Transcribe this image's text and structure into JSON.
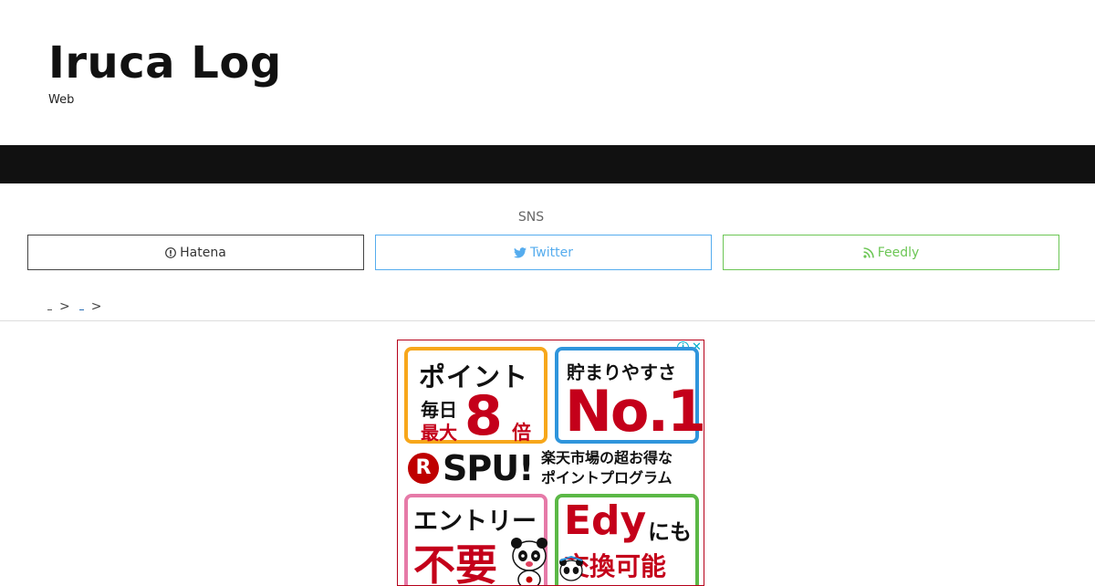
{
  "site": {
    "title": "Iruca Log",
    "description": "Web"
  },
  "sns": {
    "heading": "SNS",
    "buttons": [
      {
        "label": "Hatena",
        "icon": "hatena-icon",
        "color": "#444444"
      },
      {
        "label": "Twitter",
        "icon": "twitter-icon",
        "color": "#55acee"
      },
      {
        "label": "Feedly",
        "icon": "rss-icon",
        "color": "#6cc655"
      }
    ]
  },
  "breadcrumb": {
    "separator": ">"
  },
  "ad": {
    "panel1": {
      "head": "ポイント",
      "sub1": "毎日",
      "sub2": "最大",
      "big": "8",
      "suffix": "倍"
    },
    "panel2": {
      "head": "貯まりやすさ",
      "big": "No.1"
    },
    "logo": {
      "mark": "R",
      "text": "SPU!"
    },
    "tagline": [
      "楽天市場の超お得な",
      "ポイントプログラム"
    ],
    "panel3": {
      "head": "エントリー",
      "big": "不要"
    },
    "panel4": {
      "head": "Edy",
      "head_suffix": "にも",
      "big": "交換可能"
    },
    "colors": {
      "brand_red": "#c4001a",
      "border": "#b6001a"
    }
  }
}
